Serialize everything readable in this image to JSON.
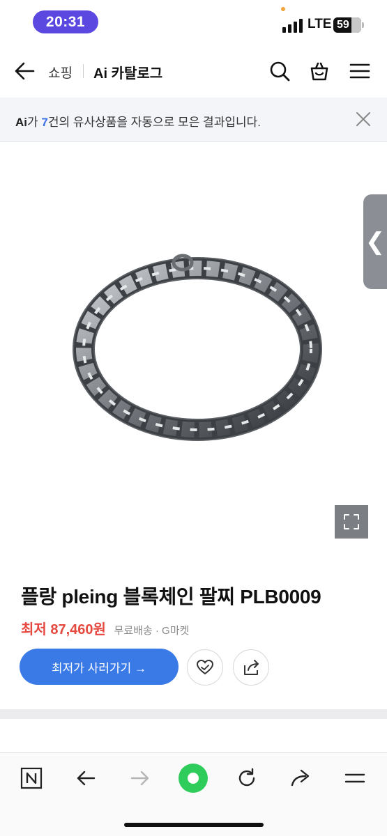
{
  "status_bar": {
    "time": "20:31",
    "network": "LTE",
    "battery": "59"
  },
  "header": {
    "breadcrumb_shop": "쇼핑",
    "title": "Ai 카탈로그",
    "icons": [
      "back-arrow-icon",
      "search-icon",
      "shopping-bag-icon",
      "menu-icon"
    ]
  },
  "ai_banner": {
    "mark": "Ai",
    "before": "가 ",
    "count": "7",
    "after": "건의 유사상품을 자동으로 모은 결과입니다."
  },
  "product": {
    "title": "플랑 pleing 블록체인 팔찌 PLB0009",
    "price_label": "최저",
    "price": "87,460원",
    "shipping": "무료배송 · G마켓",
    "buy_button": "최저가 사러가기 →"
  },
  "image_controls": {
    "side_tab": "❮"
  },
  "colors": {
    "accent_blue": "#3a7ae6",
    "price_red": "#e5483e",
    "time_pill": "#5a48e0",
    "naver_green": "#2ecc5a"
  },
  "bottom_toolbar": {
    "icons": [
      "naver-n-icon",
      "back-icon",
      "forward-icon",
      "green-dot-icon",
      "refresh-icon",
      "share-icon",
      "menu-icon"
    ]
  }
}
